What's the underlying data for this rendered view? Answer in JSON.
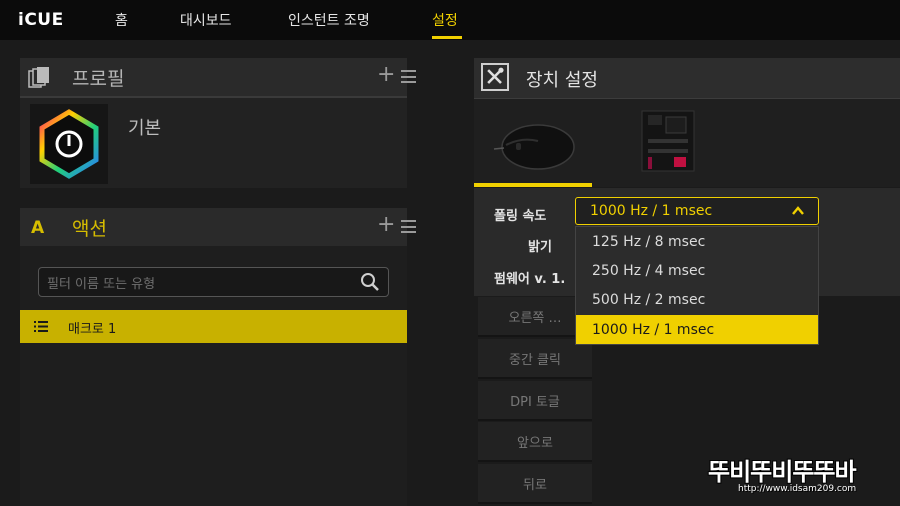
{
  "app": {
    "logo": "iCUE"
  },
  "nav": {
    "home": "홈",
    "dashboard": "대시보드",
    "instant_lighting": "인스턴트 조명",
    "settings": "설정"
  },
  "profiles": {
    "title": "프로필",
    "items": [
      {
        "label": "기본"
      }
    ]
  },
  "actions": {
    "title": "액션",
    "filter_placeholder": "필터 이름 또는 유형",
    "items": [
      {
        "label": "매크로 1"
      }
    ]
  },
  "device_settings": {
    "title": "장치 설정",
    "polling_label": "폴링 속도",
    "brightness_label": "밝기",
    "firmware_label": "펌웨어 v. 1.",
    "polling": {
      "selected": "1000 Hz / 1 msec",
      "options": [
        "125 Hz / 8 msec",
        "250 Hz / 4 msec",
        "500 Hz / 2 msec",
        "1000 Hz / 1 msec"
      ]
    }
  },
  "button_assignments": [
    "오른쪽 …",
    "중간 클릭",
    "DPI 토글",
    "앞으로",
    "뒤로"
  ],
  "watermark": {
    "text": "뚜비뚜비뚜뚜바",
    "url": "http://www.idsam209.com"
  },
  "colors": {
    "accent": "#f0d000",
    "background": "#1b1b1b"
  }
}
